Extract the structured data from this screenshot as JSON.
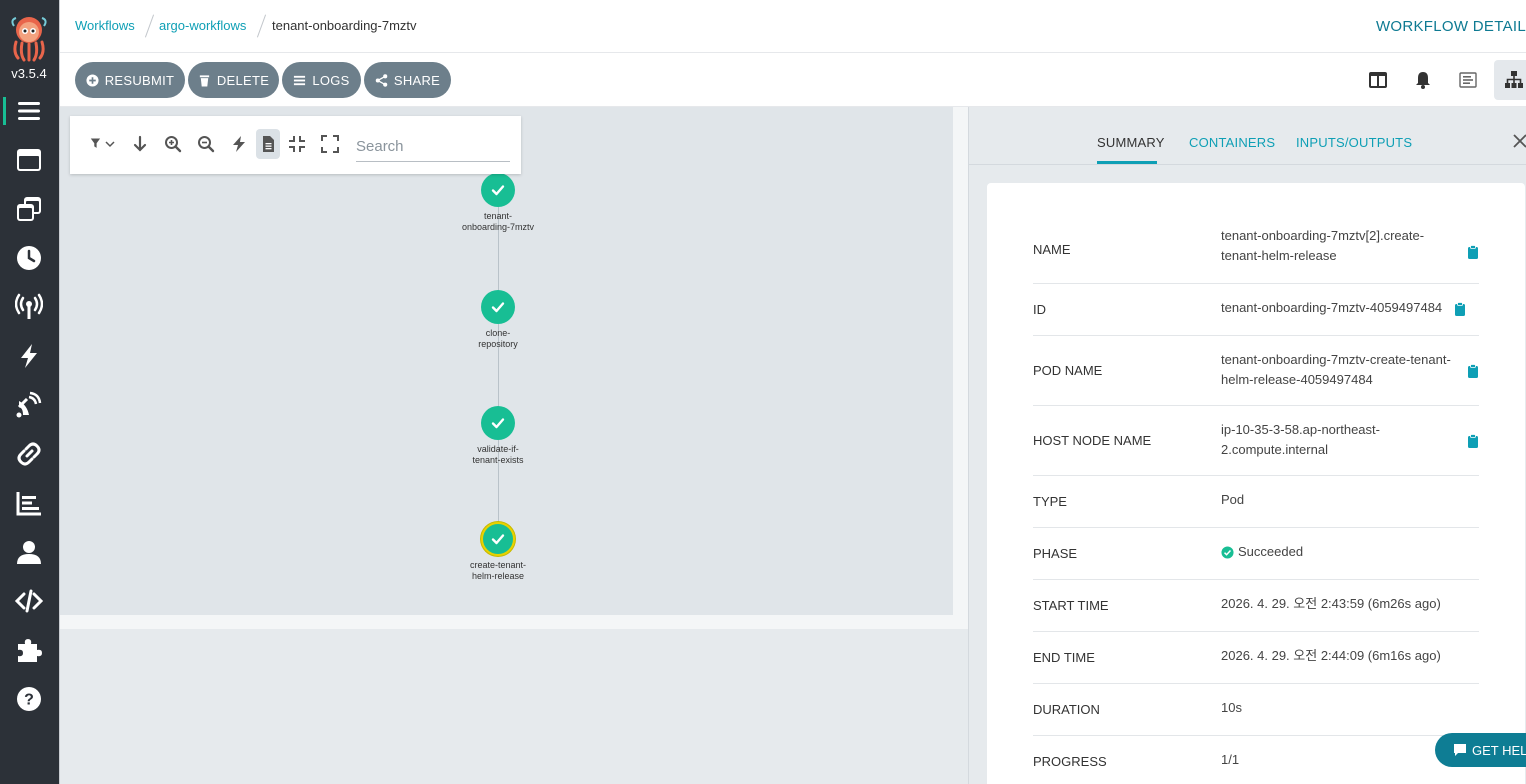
{
  "sidebar": {
    "version": "v3.5.4",
    "items": [
      {
        "name": "workflows",
        "icon": "list-icon"
      },
      {
        "name": "workflow-templates",
        "icon": "window-icon"
      },
      {
        "name": "cluster-workflow-templates",
        "icon": "clone-icon"
      },
      {
        "name": "cron-workflows",
        "icon": "clock-icon"
      },
      {
        "name": "event-sources",
        "icon": "broadcast-icon"
      },
      {
        "name": "sensors",
        "icon": "lightning-icon"
      },
      {
        "name": "event-flow",
        "icon": "satellite-icon"
      },
      {
        "name": "workflow-event-bindings",
        "icon": "link-icon"
      },
      {
        "name": "reports",
        "icon": "chart-icon"
      },
      {
        "name": "user",
        "icon": "user-icon"
      },
      {
        "name": "api-docs",
        "icon": "code-icon"
      },
      {
        "name": "plugins",
        "icon": "puzzle-icon"
      },
      {
        "name": "help",
        "icon": "question-icon"
      }
    ]
  },
  "breadcrumb": {
    "items": [
      "Workflows",
      "argo-workflows",
      "tenant-onboarding-7mztv"
    ]
  },
  "page_title": "WORKFLOW DETAIL",
  "actions": {
    "resubmit": "RESUBMIT",
    "delete": "DELETE",
    "logs": "LOGS",
    "share": "SHARE"
  },
  "graph": {
    "search_placeholder": "Search",
    "nodes": [
      {
        "label_1": "tenant-",
        "label_2": "onboarding-7mztv",
        "status": "succeeded"
      },
      {
        "label_1": "clone-",
        "label_2": "repository",
        "status": "succeeded"
      },
      {
        "label_1": "validate-if-",
        "label_2": "tenant-exists",
        "status": "succeeded"
      },
      {
        "label_1": "create-tenant-",
        "label_2": "helm-release",
        "status": "succeeded"
      }
    ]
  },
  "panel": {
    "tabs": [
      "SUMMARY",
      "CONTAINERS",
      "INPUTS/OUTPUTS"
    ],
    "rows": [
      {
        "label": "NAME",
        "value_1": "tenant-onboarding-7mztv[2].create-",
        "value_2": "tenant-helm-release"
      },
      {
        "label": "ID",
        "value_1": "tenant-onboarding-7mztv-4059497484"
      },
      {
        "label": "POD NAME",
        "value_1": "tenant-onboarding-7mztv-create-tenant-",
        "value_2": "helm-release-4059497484"
      },
      {
        "label": "HOST NODE NAME",
        "value_1": "ip-10-35-3-58.ap-northeast-",
        "value_2": "2.compute.internal"
      },
      {
        "label": "TYPE",
        "value_1": "Pod"
      },
      {
        "label": "PHASE",
        "value_1": "Succeeded"
      },
      {
        "label": "START TIME",
        "value_1": "2026. 4. 29. 오전 2:43:59 (6m26s ago)"
      },
      {
        "label": "END TIME",
        "value_1": "2026. 4. 29. 오전 2:44:09 (6m16s ago)"
      },
      {
        "label": "DURATION",
        "value_1": "10s"
      },
      {
        "label": "PROGRESS",
        "value_1": "1/1"
      }
    ]
  },
  "help_button": "GET HELP",
  "colors": {
    "accent": "#0e9fb5",
    "success": "#18be94",
    "sidebar": "#2c3138",
    "action_button": "#6d7f8b"
  }
}
